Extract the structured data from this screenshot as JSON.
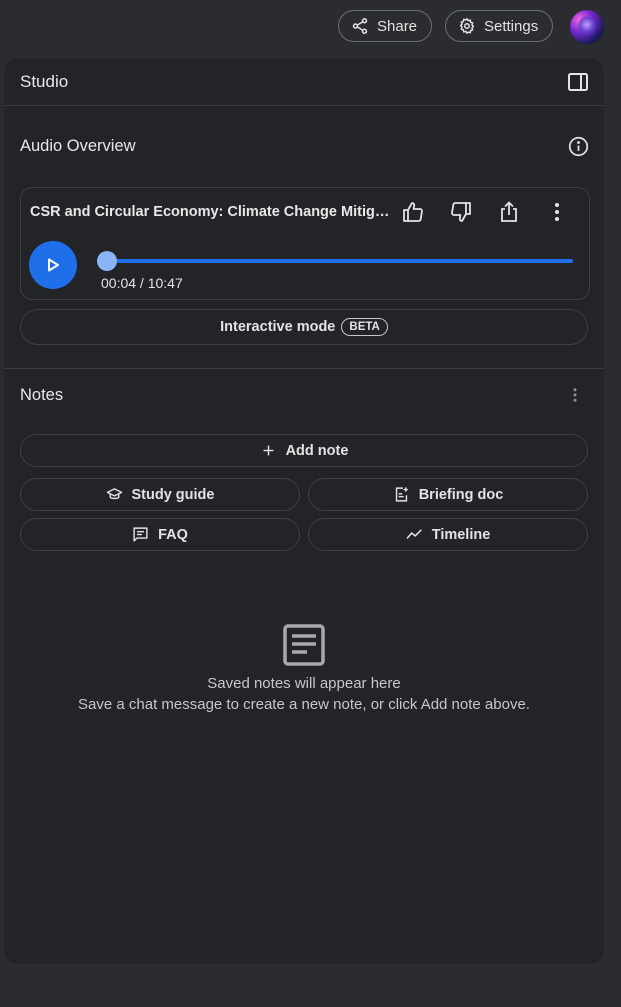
{
  "header": {
    "share_label": "Share",
    "settings_label": "Settings"
  },
  "studio": {
    "title": "Studio"
  },
  "audio_overview": {
    "title": "Audio Overview",
    "player": {
      "title": "CSR and Circular Economy: Climate Change Mitigat...",
      "time": "00:04 / 10:47",
      "progress_fraction": 0.006
    },
    "interactive_mode_label": "Interactive mode",
    "beta_label": "BETA"
  },
  "notes": {
    "title": "Notes",
    "add_note_label": "Add note",
    "study_guide_label": "Study guide",
    "briefing_doc_label": "Briefing doc",
    "faq_label": "FAQ",
    "timeline_label": "Timeline",
    "empty_title": "Saved notes will appear here",
    "empty_subtitle": "Save a chat message to create a new note, or click Add note above."
  },
  "colors": {
    "accent": "#1f6feb",
    "thumb": "#8ab4f8",
    "panel_bg": "#222428",
    "page_bg": "#2b2c2f"
  }
}
